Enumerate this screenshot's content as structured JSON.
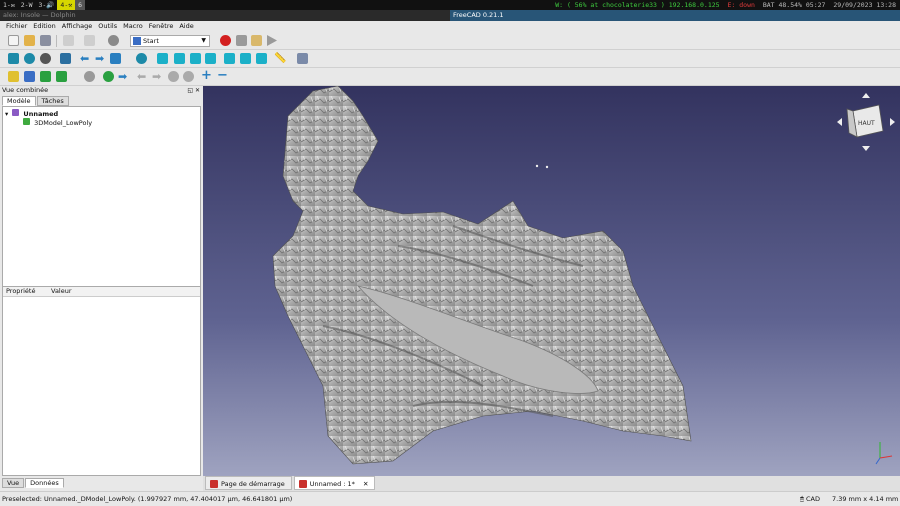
{
  "topbar": {
    "workspaces": [
      "1-✉",
      "2-W",
      "3-🔊",
      "4-⚒",
      "6"
    ],
    "status": {
      "wifi": "W: ( 56% at chocolaterie33 ) 192.168.0.125",
      "eth": "E: down",
      "battery": "BAT 48.54% 05:27",
      "datetime": "29/09/2023 13:28"
    }
  },
  "windows": {
    "left_title": "alex: Insole — Dolphin",
    "right_title": "FreeCAD  0.21.1"
  },
  "menu": [
    "Fichier",
    "Edition",
    "Affichage",
    "Outils",
    "Macro",
    "Fenêtre",
    "Aide"
  ],
  "toolbar": {
    "workbench": "Start"
  },
  "combo": {
    "title": "Vue combinée",
    "tab_model": "Modèle",
    "tab_tasks": "Tâches",
    "tree_root": "Unnamed",
    "tree_child": "3DModel_LowPoly",
    "prop_col1": "Propriété",
    "prop_col2": "Valeur",
    "tab_view": "Vue",
    "tab_data": "Données"
  },
  "navcube": {
    "face": "HAUT"
  },
  "doctabs": {
    "start_page": "Page de démarrage",
    "doc": "Unnamed : 1*"
  },
  "statusbar": {
    "message": "Preselected: Unnamed._DModel_LowPoly. (1.997927 mm, 47.404017 µm, 46.641801 µm)",
    "nav": "CAD",
    "dimensions": "7.39 mm x 4.14 mm"
  },
  "colors": {
    "accent": "#285577",
    "urgent": "#d6d600",
    "record": "#d32020"
  }
}
